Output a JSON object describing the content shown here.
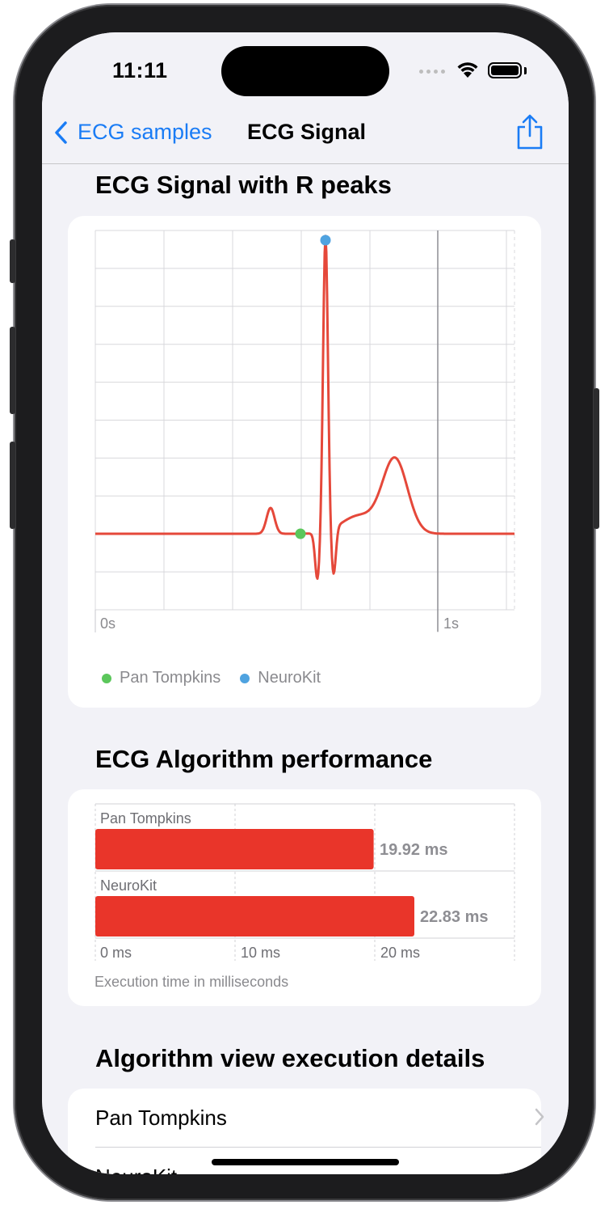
{
  "status_bar": {
    "time": "11:11"
  },
  "nav": {
    "back_label": "ECG samples",
    "title": "ECG Signal"
  },
  "sections": {
    "signal_title": "ECG Signal with R peaks",
    "performance_title": "ECG Algorithm performance",
    "details_title": "Algorithm view execution details"
  },
  "ecg_chart": {
    "x_tick_labels": [
      "0s",
      "1s"
    ],
    "legend": [
      {
        "label": "Pan Tompkins",
        "color": "#5bc75b"
      },
      {
        "label": "NeuroKit",
        "color": "#4fa3e0"
      }
    ],
    "line_color": "#e5483a"
  },
  "chart_data": {
    "type": "bar",
    "orientation": "horizontal",
    "categories": [
      "Pan Tompkins",
      "NeuroKit"
    ],
    "values": [
      19.92,
      22.83
    ],
    "value_labels": [
      "19.92 ms",
      "22.83 ms"
    ],
    "x_ticks": [
      "0 ms",
      "10 ms",
      "20 ms"
    ],
    "xlim": [
      0,
      30
    ],
    "caption": "Execution time in milliseconds",
    "bar_color": "#e9352a"
  },
  "details_list": [
    {
      "label": "Pan Tompkins"
    },
    {
      "label": "NeuroKit"
    }
  ]
}
